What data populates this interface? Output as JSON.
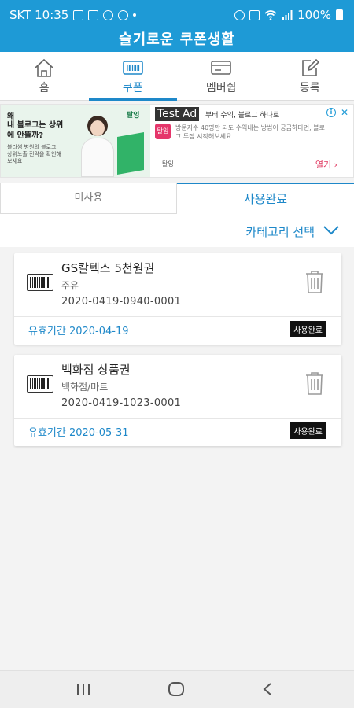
{
  "status_bar": {
    "carrier_time": "SKT 10:35",
    "battery": "100%"
  },
  "app": {
    "title": "슬기로운 쿠폰생활"
  },
  "nav": {
    "tabs": [
      {
        "label": "홈",
        "icon": "home-icon"
      },
      {
        "label": "쿠폰",
        "icon": "barcode-icon"
      },
      {
        "label": "멤버쉽",
        "icon": "card-icon"
      },
      {
        "label": "등록",
        "icon": "edit-icon"
      }
    ],
    "active": "쿠폰"
  },
  "ad": {
    "tag": "Test Ad",
    "image_title": "왜",
    "image_headline": "내 블로그는 상위에 안뜰까?",
    "image_sub": "블라썸 병원의 블로그 상위노출 전략을 확인해보세요",
    "image_brand": "탈잉",
    "logo_text": "탈잉",
    "line1": "부터 수익, 블로그 하나로",
    "body": "방문자수 40명만 되도 수익내는 방법이 궁금하다면, 블로그 투잡 시작해보세요",
    "advertiser": "탈잉",
    "open_label": "열기",
    "open_chevron": "›",
    "close_symbol": "✕",
    "info_symbol": "i"
  },
  "subtabs": {
    "unused": "미사용",
    "used": "사용완료"
  },
  "category": {
    "label": "카테고리 선택"
  },
  "coupons": [
    {
      "name": "GS칼텍스 5천원권",
      "category": "주유",
      "code": "2020-0419-0940-0001",
      "expiry": "유효기간 2020-04-19",
      "status": "사용완료"
    },
    {
      "name": "백화점 상품권",
      "category": "백화점/마트",
      "code": "2020-0419-1023-0001",
      "expiry": "유효기간 2020-05-31",
      "status": "사용완료"
    }
  ],
  "colors": {
    "brand": "#1e9ad6",
    "accent": "#1e88c9",
    "badge": "#111111"
  }
}
